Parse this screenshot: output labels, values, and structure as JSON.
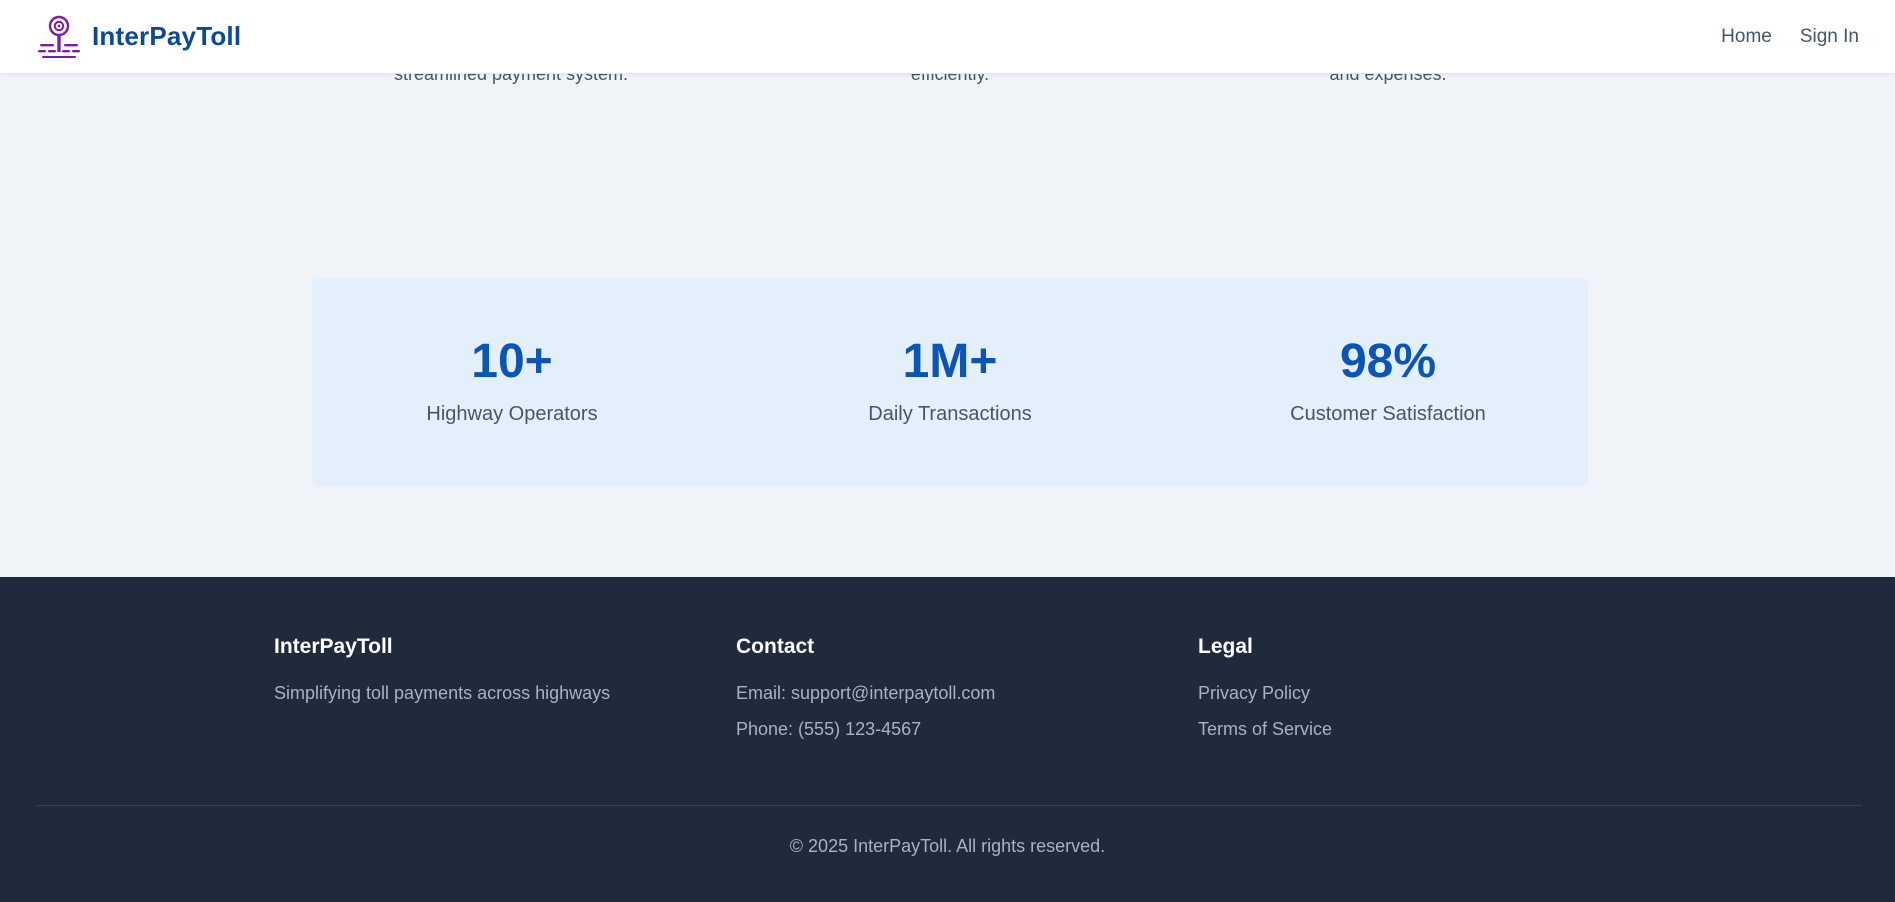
{
  "header": {
    "brand_name": "InterPayToll",
    "logo_icon": "toll-meter-icon",
    "nav": {
      "home": "Home",
      "sign_in": "Sign In"
    }
  },
  "features": {
    "items": [
      {
        "text": "streamlined payment system."
      },
      {
        "text": "efficiently."
      },
      {
        "text": "and expenses."
      }
    ]
  },
  "stats": [
    {
      "value": "10+",
      "label": "Highway Operators"
    },
    {
      "value": "1M+",
      "label": "Daily Transactions"
    },
    {
      "value": "98%",
      "label": "Customer Satisfaction"
    }
  ],
  "footer": {
    "about": {
      "title": "InterPayToll",
      "tagline": "Simplifying toll payments across highways"
    },
    "contact": {
      "title": "Contact",
      "email": "Email: support@interpaytoll.com",
      "phone": "Phone: (555) 123-4567"
    },
    "legal": {
      "title": "Legal",
      "privacy": "Privacy Policy",
      "terms": "Terms of Service"
    },
    "copyright": "© 2025 InterPayToll. All rights reserved."
  },
  "colors": {
    "brand": "#0b4a98",
    "accent": "#0b55b4",
    "logo": "#7a1fa2",
    "footer_bg": "#1f2a3c"
  }
}
